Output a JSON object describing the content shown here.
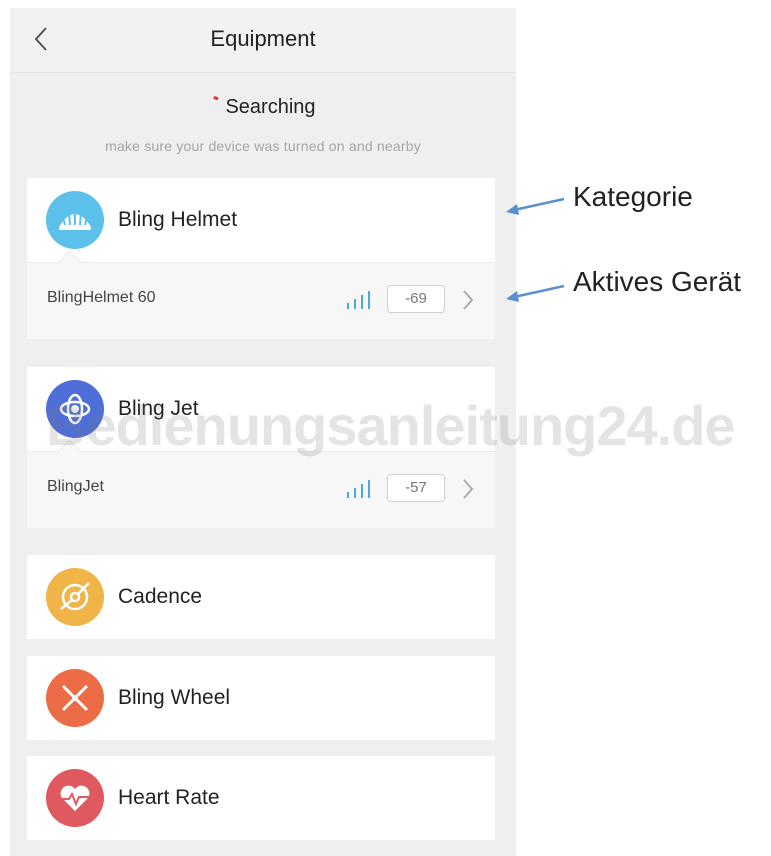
{
  "header": {
    "title": "Equipment",
    "back_icon": "chevron-left-icon"
  },
  "status": {
    "label": "Searching",
    "hint": "make sure your device was turned on and nearby"
  },
  "categories": [
    {
      "label": "Bling Helmet",
      "icon": "helmet-icon",
      "color": "#5cc1ea",
      "device": {
        "name": "BlingHelmet 60",
        "rssi": "-69",
        "signal_icon": "signal-bars-icon"
      }
    },
    {
      "label": "Bling Jet",
      "icon": "jet-icon",
      "color": "#4f6fd8",
      "device": {
        "name": "BlingJet",
        "rssi": "-57",
        "signal_icon": "signal-bars-icon"
      }
    },
    {
      "label": "Cadence",
      "icon": "cadence-icon",
      "color": "#f1b449"
    },
    {
      "label": "Bling Wheel",
      "icon": "wheel-icon",
      "color": "#ec6c45"
    },
    {
      "label": "Heart Rate",
      "icon": "heart-rate-icon",
      "color": "#df5a5e"
    }
  ],
  "annotations": {
    "category": "Kategorie",
    "active_device": "Aktives Gerät"
  },
  "watermark": "Bedienungsanleitung24.de",
  "colors": {
    "signal": "#4fa9d8",
    "arrow": "#5b8fd0",
    "searching_dot": "#d9342b"
  }
}
